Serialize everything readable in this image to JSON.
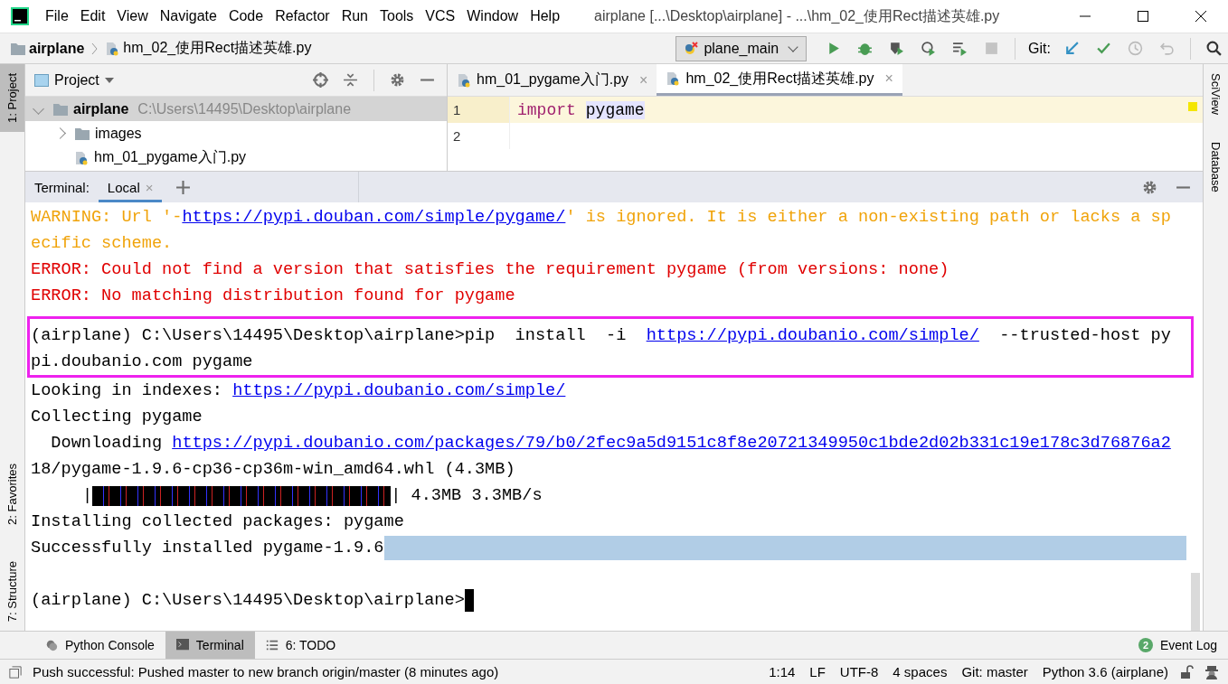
{
  "window": {
    "title": "airplane [...\\Desktop\\airplane] - ...\\hm_02_使用Rect描述英雄.py"
  },
  "menu": [
    "File",
    "Edit",
    "View",
    "Navigate",
    "Code",
    "Refactor",
    "Run",
    "Tools",
    "VCS",
    "Window",
    "Help"
  ],
  "breadcrumb": [
    {
      "label": "airplane",
      "kind": "folder"
    },
    {
      "label": "hm_02_使用Rect描述英雄.py",
      "kind": "file"
    }
  ],
  "toolbar": {
    "run_config": "plane_main",
    "git_label": "Git:",
    "actions": [
      {
        "kind": "run",
        "disabled": false
      },
      {
        "kind": "debug",
        "disabled": false
      },
      {
        "kind": "coverage",
        "disabled": false
      },
      {
        "kind": "profile",
        "disabled": false
      },
      {
        "kind": "concurrency",
        "disabled": false
      },
      {
        "kind": "stop",
        "disabled": true
      }
    ],
    "git_actions": [
      {
        "kind": "update",
        "disabled": false
      },
      {
        "kind": "commit",
        "disabled": false
      },
      {
        "kind": "history",
        "disabled": true
      },
      {
        "kind": "rollback",
        "disabled": true
      }
    ]
  },
  "left_stripe": [
    {
      "label": "1: Project",
      "selected": true
    },
    {
      "label": "2: Favorites",
      "selected": false
    },
    {
      "label": "7: Structure",
      "selected": false
    }
  ],
  "right_stripe": [
    {
      "label": "SciView"
    },
    {
      "label": "Database"
    }
  ],
  "project": {
    "title": "Project",
    "tree": [
      {
        "name": "airplane",
        "path": "C:\\Users\\14495\\Desktop\\airplane",
        "kind": "folder",
        "expanded": true,
        "selected": true,
        "children": [
          {
            "name": "images",
            "kind": "folder",
            "expanded": false,
            "selected": false
          },
          {
            "name": "hm_01_pygame入门.py",
            "kind": "file",
            "selected": false
          }
        ]
      }
    ]
  },
  "editor": {
    "tabs": [
      {
        "label": "hm_01_pygame入门.py",
        "close": "×",
        "selected": false
      },
      {
        "label": "hm_02_使用Rect描述英雄.py",
        "close": "×",
        "selected": true
      }
    ],
    "lines": [
      {
        "number": "1",
        "current": true,
        "parts": [
          {
            "text": "import",
            "kind": "keyword"
          },
          {
            "text": "pygame",
            "kind": "usage"
          }
        ]
      },
      {
        "number": "2",
        "current": false
      }
    ]
  },
  "terminal": {
    "label": "Terminal:",
    "tabs": [
      {
        "label": "Local",
        "close": "×",
        "selected": true
      }
    ],
    "blocks": [
      {
        "boxed": false,
        "lines": [
          {
            "kind": "text",
            "color": "#f0a30a",
            "selected": false,
            "parts": [
              {
                "text": "WARNING: Url '-",
                "link": false
              },
              {
                "text": "https://pypi.douban.com/simple/pygame/",
                "link": true
              },
              {
                "text": "' is ignored. It is either a non-existing path or lacks a sp",
                "link": false
              }
            ]
          },
          {
            "kind": "text",
            "color": "#f0a30a",
            "selected": false,
            "parts": [
              {
                "text": "ecific scheme.",
                "link": false
              }
            ]
          },
          {
            "kind": "text",
            "color": "#e00000",
            "selected": false,
            "parts": [
              {
                "text": "ERROR: Could not find a version that satisfies the requirement pygame (from versions: none)",
                "link": false
              }
            ]
          },
          {
            "kind": "text",
            "color": "#e00000",
            "selected": false,
            "parts": [
              {
                "text": "ERROR: No matching distribution found for pygame",
                "link": false
              }
            ]
          }
        ]
      },
      {
        "boxed": true,
        "lines": [
          {
            "kind": "text",
            "color": "#000000",
            "selected": false,
            "parts": [
              {
                "text": "(airplane) C:\\Users\\14495\\Desktop\\airplane>pip  install  -i  ",
                "link": false
              },
              {
                "text": "https://pypi.doubanio.com/simple/",
                "link": true
              },
              {
                "text": "  --trusted-host py",
                "link": false
              }
            ]
          },
          {
            "kind": "text",
            "color": "#000000",
            "selected": false,
            "parts": [
              {
                "text": "pi.doubanio.com pygame",
                "link": false
              }
            ]
          }
        ]
      },
      {
        "boxed": false,
        "lines": [
          {
            "kind": "text",
            "color": "#000000",
            "selected": false,
            "parts": [
              {
                "text": "Looking in indexes: ",
                "link": false
              },
              {
                "text": "https://pypi.doubanio.com/simple/",
                "link": true
              }
            ]
          },
          {
            "kind": "text",
            "color": "#000000",
            "selected": false,
            "parts": [
              {
                "text": "Collecting pygame",
                "link": false
              }
            ]
          },
          {
            "kind": "text",
            "color": "#000000",
            "selected": false,
            "parts": [
              {
                "text": "  Downloading ",
                "link": false
              },
              {
                "text": "https://pypi.doubanio.com/packages/79/b0/2fec9a5d9151c8f8e20721349950c1bde2d02b331c19e178c3d76876a2",
                "link": true
              }
            ]
          },
          {
            "kind": "text",
            "color": "#000000",
            "selected": false,
            "parts": [
              {
                "text": "18/pygame-1.9.6-cp36-cp36m-win_amd64.whl (4.3MB)",
                "link": false
              }
            ]
          },
          {
            "kind": "progress",
            "level": 1,
            "head": "|",
            "tail": "| 4.3MB 3.3MB/s"
          },
          {
            "kind": "text",
            "color": "#000000",
            "selected": false,
            "parts": [
              {
                "text": "Installing collected packages: pygame",
                "link": false
              }
            ]
          },
          {
            "kind": "text",
            "color": "#000000",
            "selected": true,
            "parts": [
              {
                "text": "Successfully installed pygame-1.9.6",
                "link": false
              }
            ]
          },
          {
            "kind": "blank"
          },
          {
            "kind": "prompt",
            "text": "(airplane) C:\\Users\\14495\\Desktop\\airplane>"
          }
        ]
      }
    ]
  },
  "tool_windows": [
    {
      "label": "Python Console",
      "kind": "python",
      "selected": false
    },
    {
      "label": "Terminal",
      "kind": "terminal",
      "selected": true
    },
    {
      "label": "6: TODO",
      "kind": "list",
      "selected": false
    }
  ],
  "event_log": {
    "label": "Event Log",
    "count": "2"
  },
  "status_bar": {
    "message": "Push successful: Pushed master to new branch origin/master (8 minutes ago)",
    "items": [
      "1:14",
      "LF",
      "UTF-8",
      "4 spaces",
      "Git: master",
      "Python 3.6 (airplane)"
    ]
  }
}
